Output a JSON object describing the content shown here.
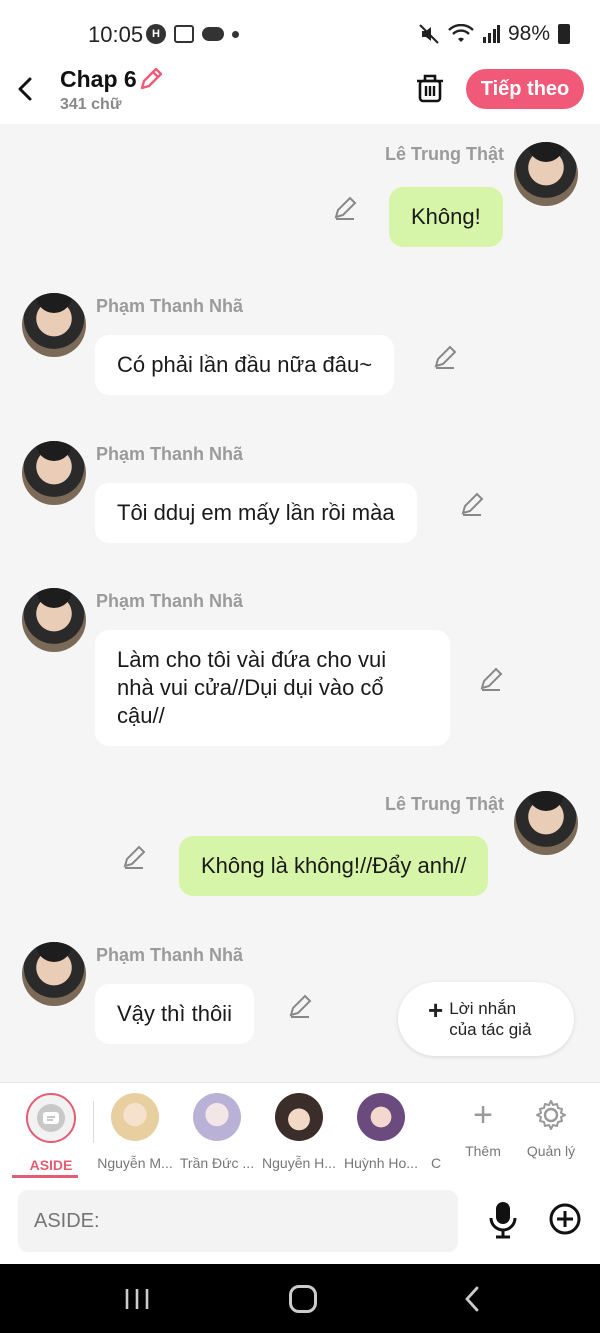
{
  "status_bar": {
    "time": "10:05",
    "battery": "98%"
  },
  "header": {
    "title": "Chap 6",
    "word_count": "341 chữ",
    "next_label": "Tiếp theo"
  },
  "messages": [
    {
      "side": "right",
      "name": "Lê Trung Thật",
      "text": "Không!"
    },
    {
      "side": "left",
      "name": "Phạm Thanh Nhã",
      "text": "Có phải lần đầu nữa đâu~"
    },
    {
      "side": "left",
      "name": "Phạm Thanh Nhã",
      "text": "Tôi dduj em mấy lần rồi màa"
    },
    {
      "side": "left",
      "name": "Phạm Thanh Nhã",
      "text": "Làm cho tôi vài đứa cho vui nhà vui cửa//Dụi dụi vào cổ cậu//"
    },
    {
      "side": "right",
      "name": "Lê Trung Thật",
      "text": "Không là không!//Đẩy anh//"
    },
    {
      "side": "left",
      "name": "Phạm Thanh Nhã",
      "text": "Vậy thì thôii"
    }
  ],
  "author_note": {
    "line1": "Lời nhắn",
    "line2": "của tác giả"
  },
  "characters": [
    {
      "label": "ASIDE",
      "color": "#e35d75"
    },
    {
      "label": "Nguyễn M...",
      "color": "#e8cfa0"
    },
    {
      "label": "Trần Đức ...",
      "color": "#b9b2d6"
    },
    {
      "label": "Nguyễn H...",
      "color": "#3a2d2a"
    },
    {
      "label": "Huỳnh Ho...",
      "color": "#6b4a7e"
    },
    {
      "label": "C",
      "color": "#ffffff"
    }
  ],
  "tools": {
    "add_label": "Thêm",
    "manage_label": "Quản lý"
  },
  "input": {
    "placeholder": "ASIDE:"
  }
}
